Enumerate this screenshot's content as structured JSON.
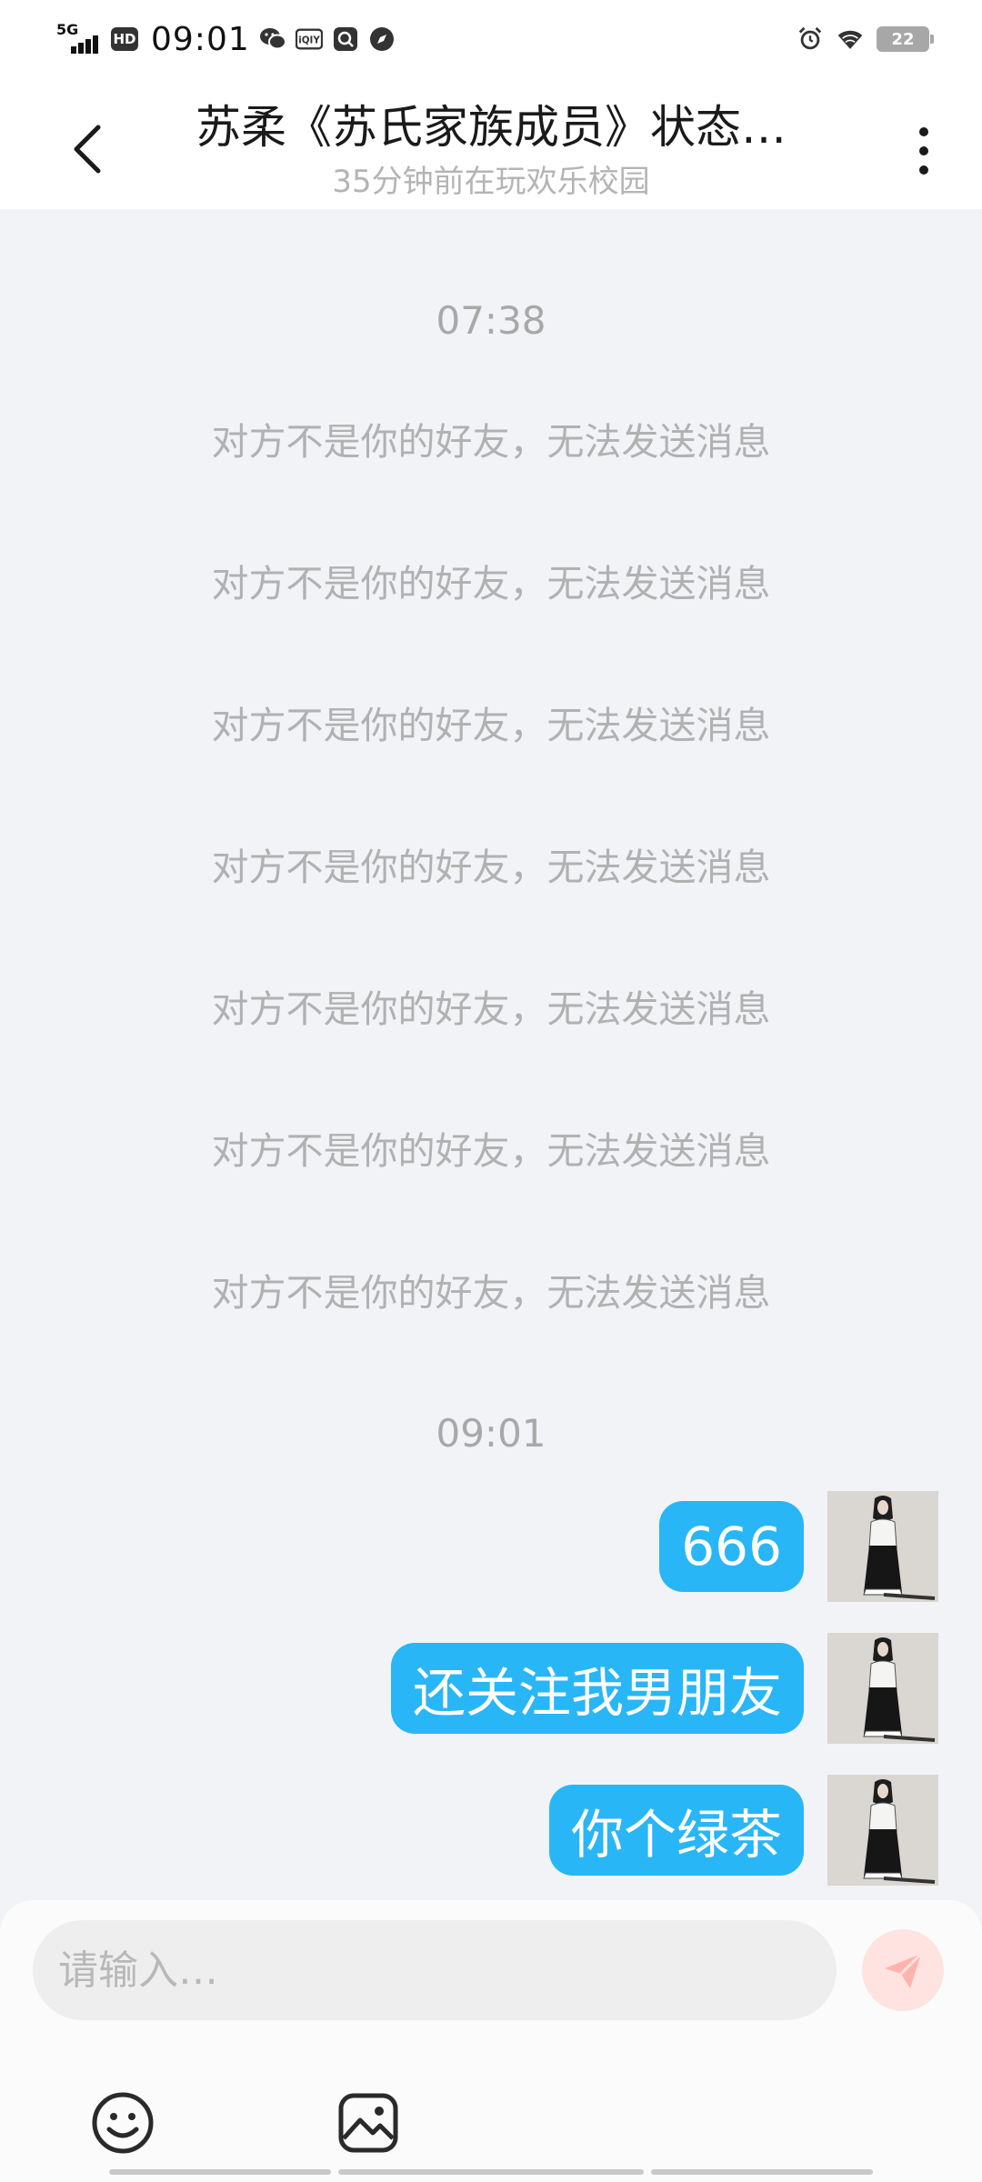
{
  "status_bar": {
    "network": "5G",
    "hd": "HD",
    "time": "09:01",
    "app_icons": [
      "wechat-icon",
      "iqiyi-icon",
      "search-app-icon",
      "compass-icon"
    ],
    "alarm_icon": "alarm-icon",
    "wifi_icon": "wifi-icon",
    "battery": "22"
  },
  "header": {
    "title": "苏柔《苏氏家族成员》状态…",
    "subtitle": "35分钟前在玩欢乐校园"
  },
  "chat": {
    "time_1": "07:38",
    "system_messages": [
      "对方不是你的好友，无法发送消息",
      "对方不是你的好友，无法发送消息",
      "对方不是你的好友，无法发送消息",
      "对方不是你的好友，无法发送消息",
      "对方不是你的好友，无法发送消息",
      "对方不是你的好友，无法发送消息",
      "对方不是你的好友，无法发送消息"
    ],
    "time_2": "09:01",
    "sent_messages": [
      "666",
      "还关注我男朋友",
      "你个绿茶"
    ]
  },
  "input": {
    "placeholder": "请输入…",
    "value": ""
  },
  "colors": {
    "bubble": "#29b6f6",
    "background": "#f1f3f6",
    "send_button": "#ffe3e1",
    "send_icon": "#ffb3ad"
  }
}
